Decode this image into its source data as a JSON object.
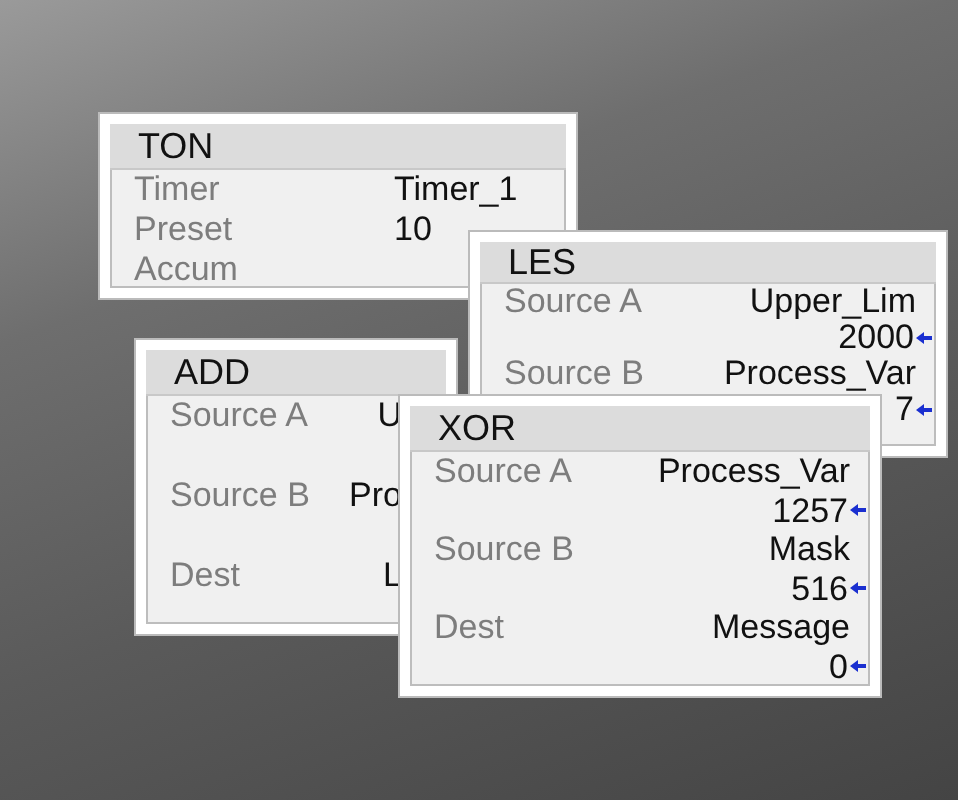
{
  "blocks": [
    {
      "title": "TON",
      "rows": [
        {
          "label": "Timer",
          "tag": "Timer_1"
        },
        {
          "label": "Preset",
          "tag": "10"
        },
        {
          "label": "Accum"
        }
      ]
    },
    {
      "title": "LES",
      "rows": [
        {
          "label": "Source A",
          "tag": "Upper_Lim",
          "value": "2000"
        },
        {
          "label": "Source B",
          "tag": "Process_Var",
          "value": "7"
        }
      ]
    },
    {
      "title": "ADD",
      "rows": [
        {
          "label": "Source A",
          "tag": "U"
        },
        {
          "label": "Source B",
          "tag": "Pro"
        },
        {
          "label": "Dest",
          "tag": "L"
        }
      ]
    },
    {
      "title": "XOR",
      "rows": [
        {
          "label": "Source A",
          "tag": "Process_Var",
          "value": "1257"
        },
        {
          "label": "Source B",
          "tag": "Mask",
          "value": "516"
        },
        {
          "label": "Dest",
          "tag": "Message",
          "value": "0"
        }
      ]
    }
  ]
}
